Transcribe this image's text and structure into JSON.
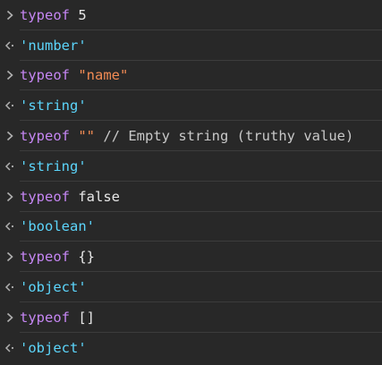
{
  "colors": {
    "background": "#282828",
    "divider": "#3c3c3c",
    "keyword": "#c586f3",
    "string_literal": "#f28b54",
    "output_string": "#5cd5fb",
    "plain_text": "#e8e8e8",
    "prompt_icon": "#b0b0b0"
  },
  "icons": {
    "input_prompt": "chevron-right-icon",
    "result": "return-arrow-icon"
  },
  "entries": [
    {
      "keyword": "typeof",
      "operand": "5",
      "comment": "",
      "result": "'number'"
    },
    {
      "keyword": "typeof",
      "operand": "\"name\"",
      "comment": "",
      "result": "'string'"
    },
    {
      "keyword": "typeof",
      "operand": "\"\"",
      "comment": "// Empty string (truthy value)",
      "result": "'string'"
    },
    {
      "keyword": "typeof",
      "operand": "false",
      "comment": "",
      "result": "'boolean'"
    },
    {
      "keyword": "typeof",
      "operand": "{}",
      "comment": "",
      "result": "'object'"
    },
    {
      "keyword": "typeof",
      "operand": "[]",
      "comment": "",
      "result": "'object'"
    }
  ]
}
